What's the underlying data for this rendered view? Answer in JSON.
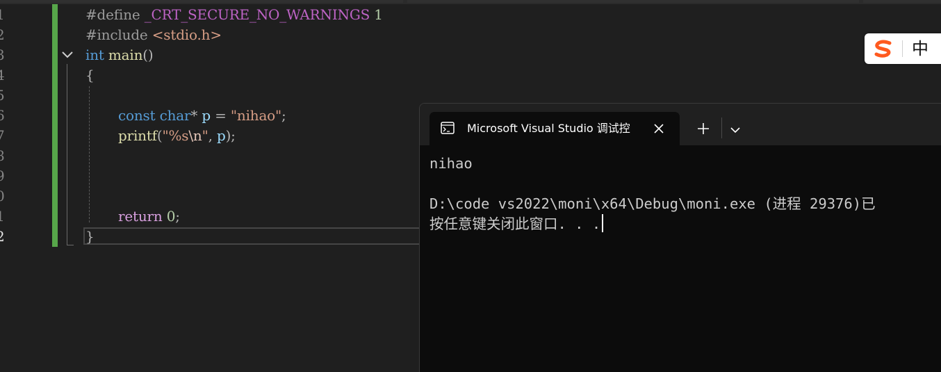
{
  "editor": {
    "line_numbers": [
      "1",
      "2",
      "3",
      "4",
      "5",
      "6",
      "7",
      "8",
      "9",
      "0",
      "1",
      "2"
    ],
    "lines": {
      "l1": {
        "kw": "#define",
        "macro": "_CRT_SECURE_NO_WARNINGS",
        "num": "1"
      },
      "l2": {
        "kw": "#include",
        "header": "<stdio.h>"
      },
      "l3": {
        "type": "int",
        "name": "main",
        "parens": "()"
      },
      "l4": {
        "brace": "{"
      },
      "l6": {
        "kw1": "const",
        "kw2": "char",
        "star": "*",
        "var": "p",
        "eq": "=",
        "str": "\"nihao\"",
        "semi": ";"
      },
      "l7": {
        "fn": "printf",
        "open": "(",
        "str_a": "\"%s",
        "esc": "\\n",
        "str_b": "\"",
        "comma": ",",
        "var": "p",
        "close": ");"
      },
      "l11": {
        "kw": "return",
        "num": "0",
        "semi": ";"
      },
      "l12": {
        "brace": "}"
      }
    }
  },
  "ime": {
    "logo_icon": "sogou-s-icon",
    "mode": "中",
    "accent": "#ff5a1f"
  },
  "terminal": {
    "tab_icon": "console-icon",
    "tab_title": "Microsoft Visual Studio 调试控",
    "close_icon": "close-icon",
    "new_tab_icon": "plus-icon",
    "dropdown_icon": "chevron-down-icon",
    "output": [
      "nihao",
      "",
      "D:\\code vs2022\\moni\\x64\\Debug\\moni.exe (进程 29376)已",
      "按任意键关闭此窗口. . ."
    ]
  },
  "colors": {
    "editor_bg": "#1f1f1f",
    "change_bar": "#57a64a",
    "terminal_bg": "#0c0c0c",
    "terminal_titlebar": "#202020"
  }
}
